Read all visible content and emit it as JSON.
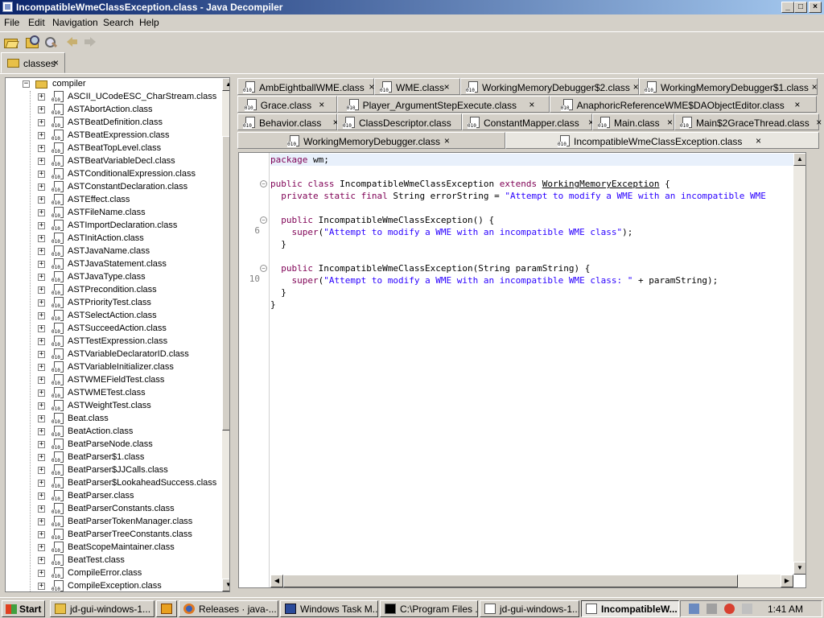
{
  "window": {
    "title": "IncompatibleWmeClassException.class - Java Decompiler",
    "buttons": {
      "minimize": "_",
      "maximize": "□",
      "close": "×"
    }
  },
  "menu": [
    "File",
    "Edit",
    "Navigation",
    "Search",
    "Help"
  ],
  "top_tab": {
    "label": "classes",
    "close": "×"
  },
  "tree": {
    "folder": {
      "expander": "−",
      "label": "compiler"
    },
    "expander_symbol": "+",
    "items": [
      "ASCII_UCodeESC_CharStream.class",
      "ASTAbortAction.class",
      "ASTBeatDefinition.class",
      "ASTBeatExpression.class",
      "ASTBeatTopLevel.class",
      "ASTBeatVariableDecl.class",
      "ASTConditionalExpression.class",
      "ASTConstantDeclaration.class",
      "ASTEffect.class",
      "ASTFileName.class",
      "ASTImportDeclaration.class",
      "ASTInitAction.class",
      "ASTJavaName.class",
      "ASTJavaStatement.class",
      "ASTJavaType.class",
      "ASTPrecondition.class",
      "ASTPriorityTest.class",
      "ASTSelectAction.class",
      "ASTSucceedAction.class",
      "ASTTestExpression.class",
      "ASTVariableDeclaratorID.class",
      "ASTVariableInitializer.class",
      "ASTWMEFieldTest.class",
      "ASTWMETest.class",
      "ASTWeightTest.class",
      "Beat.class",
      "BeatAction.class",
      "BeatParseNode.class",
      "BeatParser$1.class",
      "BeatParser$JJCalls.class",
      "BeatParser$LookaheadSuccess.class",
      "BeatParser.class",
      "BeatParserConstants.class",
      "BeatParserTokenManager.class",
      "BeatParserTreeConstants.class",
      "BeatScopeMaintainer.class",
      "BeatTest.class",
      "CompileError.class",
      "CompileException.class"
    ]
  },
  "editor_tabs": {
    "close": "×",
    "rows": [
      [
        "AmbEightballWME.class",
        "WME.class",
        "WorkingMemoryDebugger$2.class",
        "WorkingMemoryDebugger$1.class"
      ],
      [
        "Grace.class",
        "Player_ArgumentStepExecute.class",
        "AnaphoricReferenceWME$DAObjectEditor.class"
      ],
      [
        "Behavior.class",
        "ClassDescriptor.class",
        "ConstantMapper.class",
        "Main.class",
        "Main$2GraceThread.class"
      ],
      [
        "WorkingMemoryDebugger.class",
        "IncompatibleWmeClassException.class"
      ]
    ],
    "active": "IncompatibleWmeClassException.class"
  },
  "code": {
    "line_numbers": {
      "l6": "6",
      "l10": "10"
    },
    "fold_symbol": "−",
    "package_kw": "package",
    "package_name": " wm;",
    "class_kw": "public class",
    "class_name": " IncompatibleWmeClassException ",
    "extends_kw": "extends",
    "superclass": "WorkingMemoryException",
    "class_open": " {",
    "field_kw": "  private static final",
    "field_decl": " String errorString = ",
    "field_value": "\"Attempt to modify a WME with an incompatible WME",
    "ctor1_kw": "  public",
    "ctor1_sig": " IncompatibleWmeClassException() {",
    "super1_kw": "    super",
    "super1_open": "(",
    "super1_str": "\"Attempt to modify a WME with an incompatible WME class\"",
    "super1_close": ");",
    "close_brace_1": "  }",
    "ctor2_kw": "  public",
    "ctor2_sig": " IncompatibleWmeClassException(String paramString) {",
    "super2_kw": "    super",
    "super2_open": "(",
    "super2_str": "\"Attempt to modify a WME with an incompatible WME class: \"",
    "super2_rest": " + paramString);",
    "close_brace_2": "  }",
    "class_close": "}"
  },
  "taskbar": {
    "start": "Start",
    "tasks": [
      {
        "label": "jd-gui-windows-1...",
        "icon": "folder-icon"
      },
      {
        "label": "",
        "icon": "media-player-icon"
      },
      {
        "label": "Releases · java-...",
        "icon": "firefox-icon"
      },
      {
        "label": "Windows Task M...",
        "icon": "task-manager-icon"
      },
      {
        "label": "C:\\Program Files ...",
        "icon": "cmd-icon"
      },
      {
        "label": "jd-gui-windows-1...",
        "icon": "jd-gui-icon"
      },
      {
        "label": "IncompatibleW...",
        "icon": "jd-gui-icon"
      }
    ],
    "clock": "1:41 AM"
  },
  "colors": {
    "titlebar": "#0a246a",
    "keyword": "#7f0055",
    "string": "#2a00ff",
    "current_line": "#e8f0fb"
  }
}
